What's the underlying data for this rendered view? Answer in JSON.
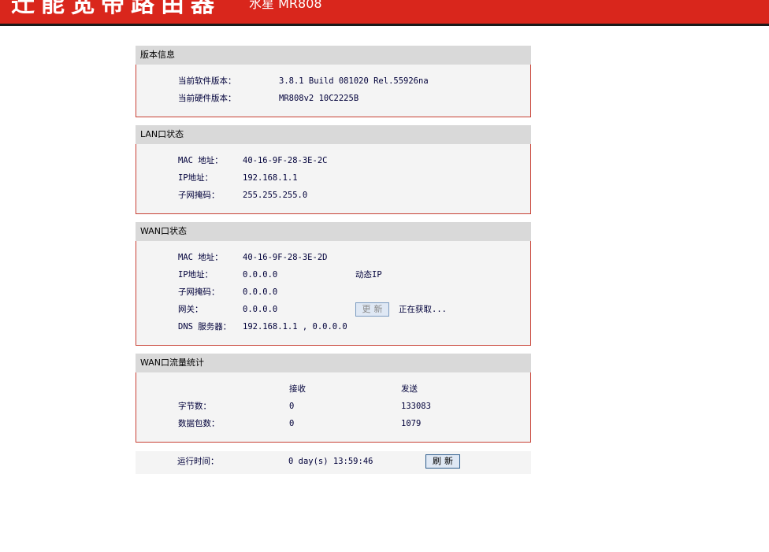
{
  "header": {
    "title": "迁能宽带路由器",
    "model": "水星 MR808"
  },
  "version_info": {
    "title": "版本信息",
    "software_label": "当前软件版本：",
    "software_value": "3.8.1 Build 081020 Rel.55926na",
    "hardware_label": "当前硬件版本：",
    "hardware_value": "MR808v2 10C2225B"
  },
  "lan_status": {
    "title": "LAN口状态",
    "mac_label": "MAC 地址：",
    "mac_value": "40-16-9F-28-3E-2C",
    "ip_label": "IP地址：",
    "ip_value": "192.168.1.1",
    "mask_label": "子网掩码：",
    "mask_value": "255.255.255.0"
  },
  "wan_status": {
    "title": "WAN口状态",
    "mac_label": "MAC 地址：",
    "mac_value": "40-16-9F-28-3E-2D",
    "ip_label": "IP地址：",
    "ip_value": "0.0.0.0",
    "ip_type": "动态IP",
    "mask_label": "子网掩码：",
    "mask_value": "0.0.0.0",
    "gateway_label": "网关：",
    "gateway_value": "0.0.0.0",
    "update_button": "更新",
    "status_text": "正在获取...",
    "dns_label": "DNS 服务器：",
    "dns_value": "192.168.1.1 , 0.0.0.0"
  },
  "wan_traffic": {
    "title": "WAN口流量统计",
    "recv_header": "接收",
    "send_header": "发送",
    "bytes_label": "字节数：",
    "bytes_recv": "0",
    "bytes_send": "133083",
    "packets_label": "数据包数：",
    "packets_recv": "0",
    "packets_send": "1079"
  },
  "uptime": {
    "label": "运行时间：",
    "value": "0 day(s) 13:59:46",
    "refresh_button": "刷新"
  }
}
